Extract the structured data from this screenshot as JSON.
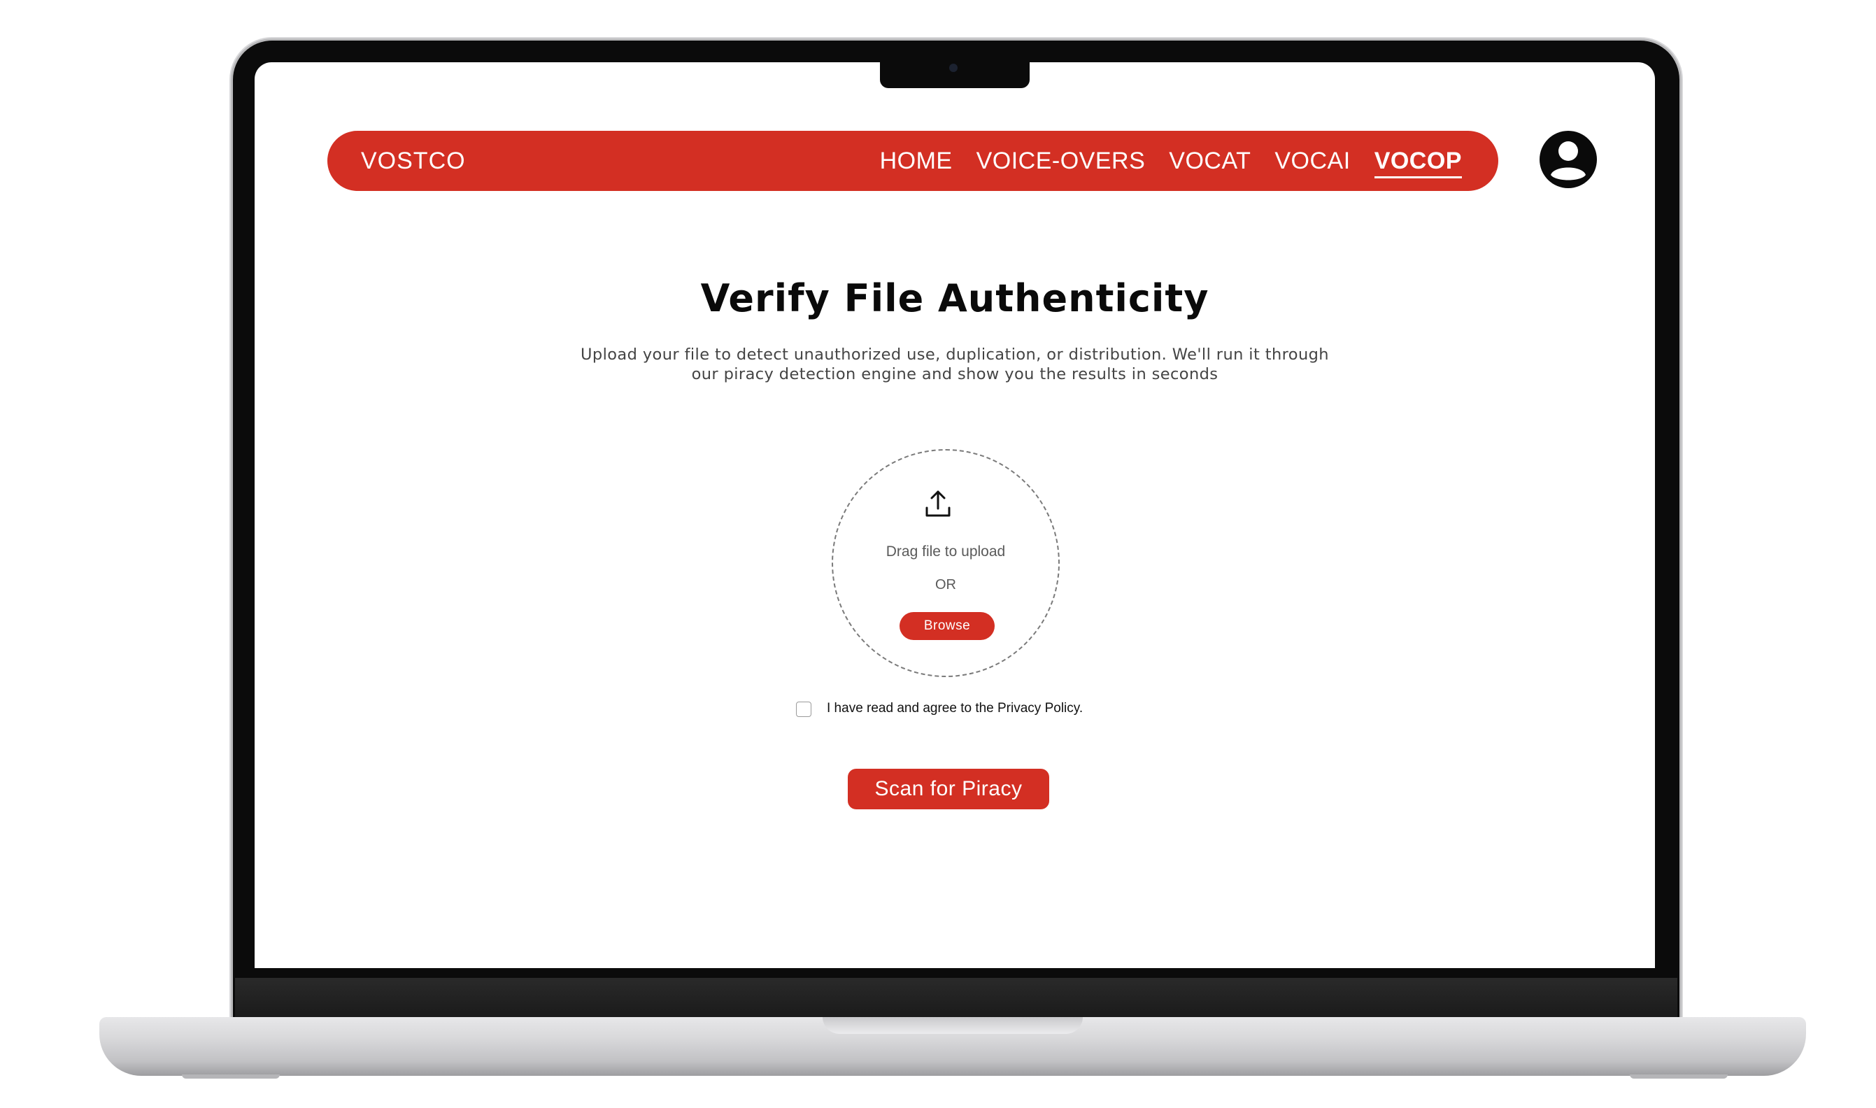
{
  "navbar": {
    "brand": "VOSTCO",
    "links": [
      {
        "label": "HOME"
      },
      {
        "label": "VOICE-OVERS"
      },
      {
        "label": "VOCAT"
      },
      {
        "label": "VOCAI"
      },
      {
        "label": "VOCOP",
        "active": true
      }
    ]
  },
  "page": {
    "title": "Verify File Authenticity",
    "subtitle_line1": "Upload your file to detect unauthorized use, duplication, or distribution. We'll run it through",
    "subtitle_line2": "our piracy detection engine and show you the results in seconds"
  },
  "upload": {
    "drag_text": "Drag file to upload",
    "or_text": "OR",
    "browse_label": "Browse"
  },
  "consent": {
    "label": "I have read and agree to the Privacy Policy.",
    "checked": false
  },
  "actions": {
    "scan_label": "Scan for Piracy"
  },
  "colors": {
    "accent": "#d32f23",
    "text": "#0a0a0a",
    "muted": "#5a5a5a"
  },
  "icons": {
    "profile": "user-circle-icon",
    "upload": "upload-icon"
  }
}
